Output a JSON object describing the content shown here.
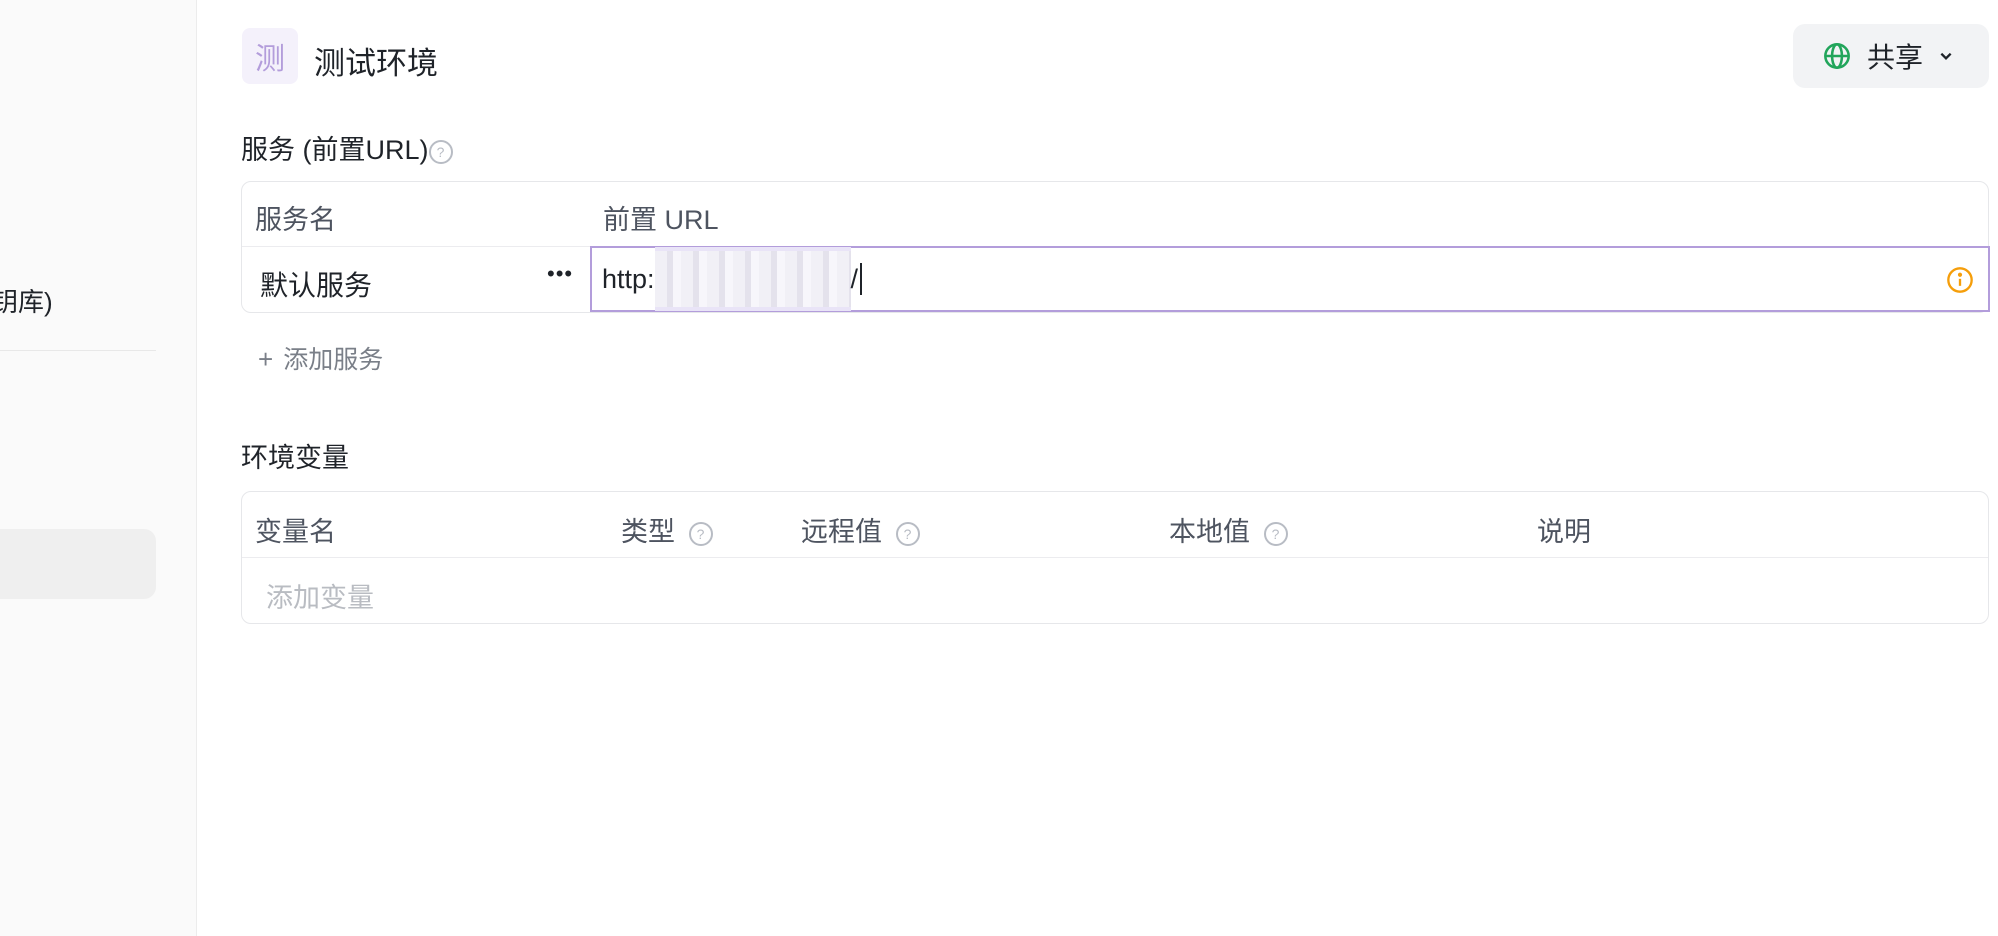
{
  "sidebar": {
    "partial_item_label": "钥库)"
  },
  "header": {
    "env_badge": "测",
    "env_title": "测试环境",
    "share_label": "共享"
  },
  "services": {
    "section_label": "服务 (前置URL)",
    "help_glyph": "?",
    "columns": [
      "服务名",
      "前置 URL"
    ],
    "rows": [
      {
        "name": "默认服务",
        "url_prefix": "http:",
        "url_suffix": "/"
      }
    ],
    "add_label": "添加服务"
  },
  "variables": {
    "section_label": "环境变量",
    "columns": [
      {
        "label": "变量名"
      },
      {
        "label": "类型"
      },
      {
        "label": "远程值"
      },
      {
        "label": "本地值"
      },
      {
        "label": "说明"
      }
    ],
    "placeholder": "添加变量"
  },
  "colors": {
    "accent": "#b39ddb",
    "share_icon": "#22a55b",
    "warning": "#f59e0b"
  },
  "icons": {
    "share": "globe-icon",
    "chevron": "chevron-down-icon",
    "help": "help-circle-icon",
    "warning": "info-warning-icon",
    "more": "more-dots-icon",
    "add": "plus-icon"
  }
}
